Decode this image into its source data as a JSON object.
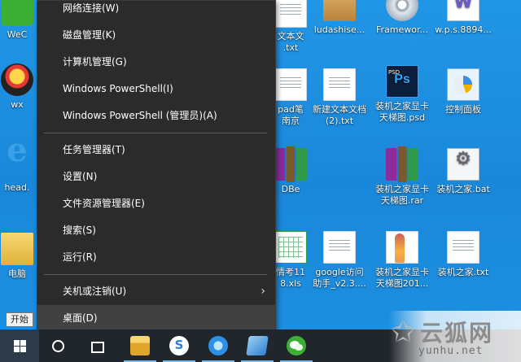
{
  "menu": {
    "items": [
      {
        "label": "网络连接(W)",
        "name": "menu-item-network-connections"
      },
      {
        "label": "磁盘管理(K)",
        "name": "menu-item-disk-management"
      },
      {
        "label": "计算机管理(G)",
        "name": "menu-item-computer-management"
      },
      {
        "label": "Windows PowerShell(I)",
        "name": "menu-item-powershell"
      },
      {
        "label": "Windows PowerShell (管理员)(A)",
        "name": "menu-item-powershell-admin"
      },
      {
        "label": "任务管理器(T)",
        "name": "menu-item-task-manager"
      },
      {
        "label": "设置(N)",
        "name": "menu-item-settings"
      },
      {
        "label": "文件资源管理器(E)",
        "name": "menu-item-file-explorer"
      },
      {
        "label": "搜索(S)",
        "name": "menu-item-search"
      },
      {
        "label": "运行(R)",
        "name": "menu-item-run"
      },
      {
        "label": "关机或注销(U)",
        "name": "menu-item-shutdown-signout",
        "submenu": true
      },
      {
        "label": "桌面(D)",
        "name": "menu-item-desktop",
        "selected": true
      }
    ],
    "submenu_arrow": "›"
  },
  "tooltip": {
    "text": "开始"
  },
  "desktop": {
    "icons": [
      {
        "label": "WeC",
        "kind": "wechat"
      },
      {
        "label": "wx",
        "kind": "qq"
      },
      {
        "label": "head.",
        "kind": "ie"
      },
      {
        "label": "电脑",
        "kind": "folder"
      },
      {
        "label": "文本文\n.txt",
        "kind": "doc"
      },
      {
        "label": "pad笔\n南京",
        "kind": "doc"
      },
      {
        "label": "DBe",
        "kind": "rar"
      },
      {
        "label": "情考11\n8.xls",
        "kind": "xls"
      },
      {
        "label": "ludashise...",
        "kind": "box"
      },
      {
        "label": "新建文本文档\n(2).txt",
        "kind": "doc"
      },
      {
        "label": "google访问\n助手_v2.3....",
        "kind": "doc"
      },
      {
        "label": "Framewor...",
        "kind": "dvd"
      },
      {
        "label": "装机之家显卡\n天梯图.psd",
        "kind": "ps"
      },
      {
        "label": "装机之家显卡\n天梯图.rar",
        "kind": "rar"
      },
      {
        "label": "装机之家显卡\n天梯图201...",
        "kind": "fan"
      },
      {
        "label": "w.p.s.8894...",
        "kind": "wps"
      },
      {
        "label": "控制面板",
        "kind": "ctrl"
      },
      {
        "label": "装机之家.bat",
        "kind": "bat"
      },
      {
        "label": "装机之家.txt",
        "kind": "doc"
      }
    ]
  },
  "taskbar": {
    "buttons": [
      {
        "name": "start-button",
        "icon": "windows-logo-icon"
      },
      {
        "name": "cortana-button",
        "icon": "cortana-circle-icon"
      },
      {
        "name": "task-view-button",
        "icon": "task-view-icon"
      },
      {
        "name": "taskbar-file-explorer",
        "icon": "folder-icon"
      },
      {
        "name": "taskbar-sogou",
        "icon": "sogou-icon"
      },
      {
        "name": "taskbar-browser",
        "icon": "browser-icon"
      },
      {
        "name": "taskbar-notes",
        "icon": "notes-icon"
      },
      {
        "name": "taskbar-wechat",
        "icon": "wechat-icon"
      }
    ]
  },
  "watermark": {
    "title": "云狐网",
    "subtitle": "yunhu.net"
  },
  "colors": {
    "menu_bg": "#2b2b2b",
    "menu_selected": "#414141",
    "desktop_bg": "#1f8ee0",
    "taskbar_bg": "#20262c",
    "accent": "#76b9ed"
  }
}
